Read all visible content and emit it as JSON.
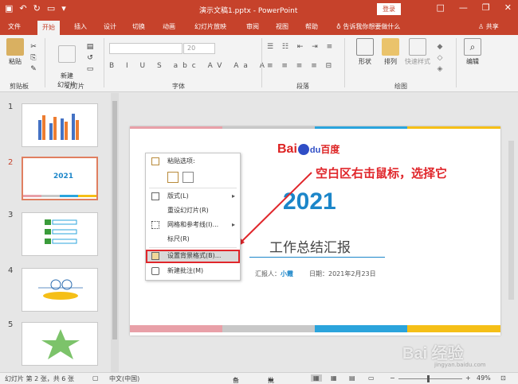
{
  "titlebar": {
    "title": "演示文稿1.pptx - PowerPoint",
    "login": "登录",
    "qat": [
      "save-icon",
      "undo-icon",
      "redo-icon",
      "present-icon",
      "dropdown-icon"
    ],
    "win": {
      "restore": "□",
      "minimize": "—",
      "maximize": "❐",
      "close": "✕"
    }
  },
  "tabs": [
    "文件",
    "开始",
    "插入",
    "设计",
    "切换",
    "动画",
    "幻灯片放映",
    "审阅",
    "视图",
    "帮助",
    "告诉我你想要做什么",
    "共享"
  ],
  "active_tab": "开始",
  "ribbon": {
    "paste": "粘贴",
    "new_slide": "新建\n幻灯片",
    "shape": "形状",
    "arrange": "排列",
    "quick_style": "快速样式",
    "edit": "编辑",
    "font_size": "20",
    "groups": [
      "剪贴板",
      "幻灯片",
      "字体",
      "段落",
      "绘图"
    ]
  },
  "thumbnails": [
    {
      "num": "1",
      "label": ""
    },
    {
      "num": "2",
      "label": "2021",
      "selected": true
    },
    {
      "num": "3",
      "label": ""
    },
    {
      "num": "4",
      "label": ""
    },
    {
      "num": "5",
      "label": ""
    }
  ],
  "slide": {
    "logo_bai": "Bai",
    "logo_du": "du",
    "logo_cn": "百度",
    "annotation": "空白区右击鼠标，选择它",
    "year": "2021",
    "subtitle": "工作总结汇报",
    "reporter_label": "汇报人：",
    "reporter_name": "小霞",
    "date": "日期：2021年2月23日",
    "stripe_colors": [
      "#e8a0a8",
      "#c8c8c8",
      "#2ba4dc",
      "#f5bf17"
    ]
  },
  "context_menu": {
    "items": [
      {
        "label": "粘贴选项:",
        "icon": "paste-icon"
      },
      {
        "label": "",
        "icon": "paste-options-icon"
      },
      {
        "label": "版式(L)",
        "icon": "layout-icon",
        "submenu": true
      },
      {
        "label": "重设幻灯片(R)",
        "icon": ""
      },
      {
        "label": "网格和参考线(I)...",
        "icon": "grid-icon",
        "submenu": true
      },
      {
        "label": "标尺(R)",
        "icon": ""
      },
      {
        "label": "设置背景格式(B)...",
        "icon": "background-icon",
        "highlighted": true
      },
      {
        "label": "新建批注(M)",
        "icon": "comment-icon"
      }
    ]
  },
  "statusbar": {
    "slide_info": "幻灯片 第 2 张，共 6 张",
    "language": "中文(中国)",
    "notes": "备注",
    "comments": "批注",
    "zoom": "49%"
  },
  "watermark": "Bai 经验",
  "watermark_url": "jingyan.baidu.com"
}
